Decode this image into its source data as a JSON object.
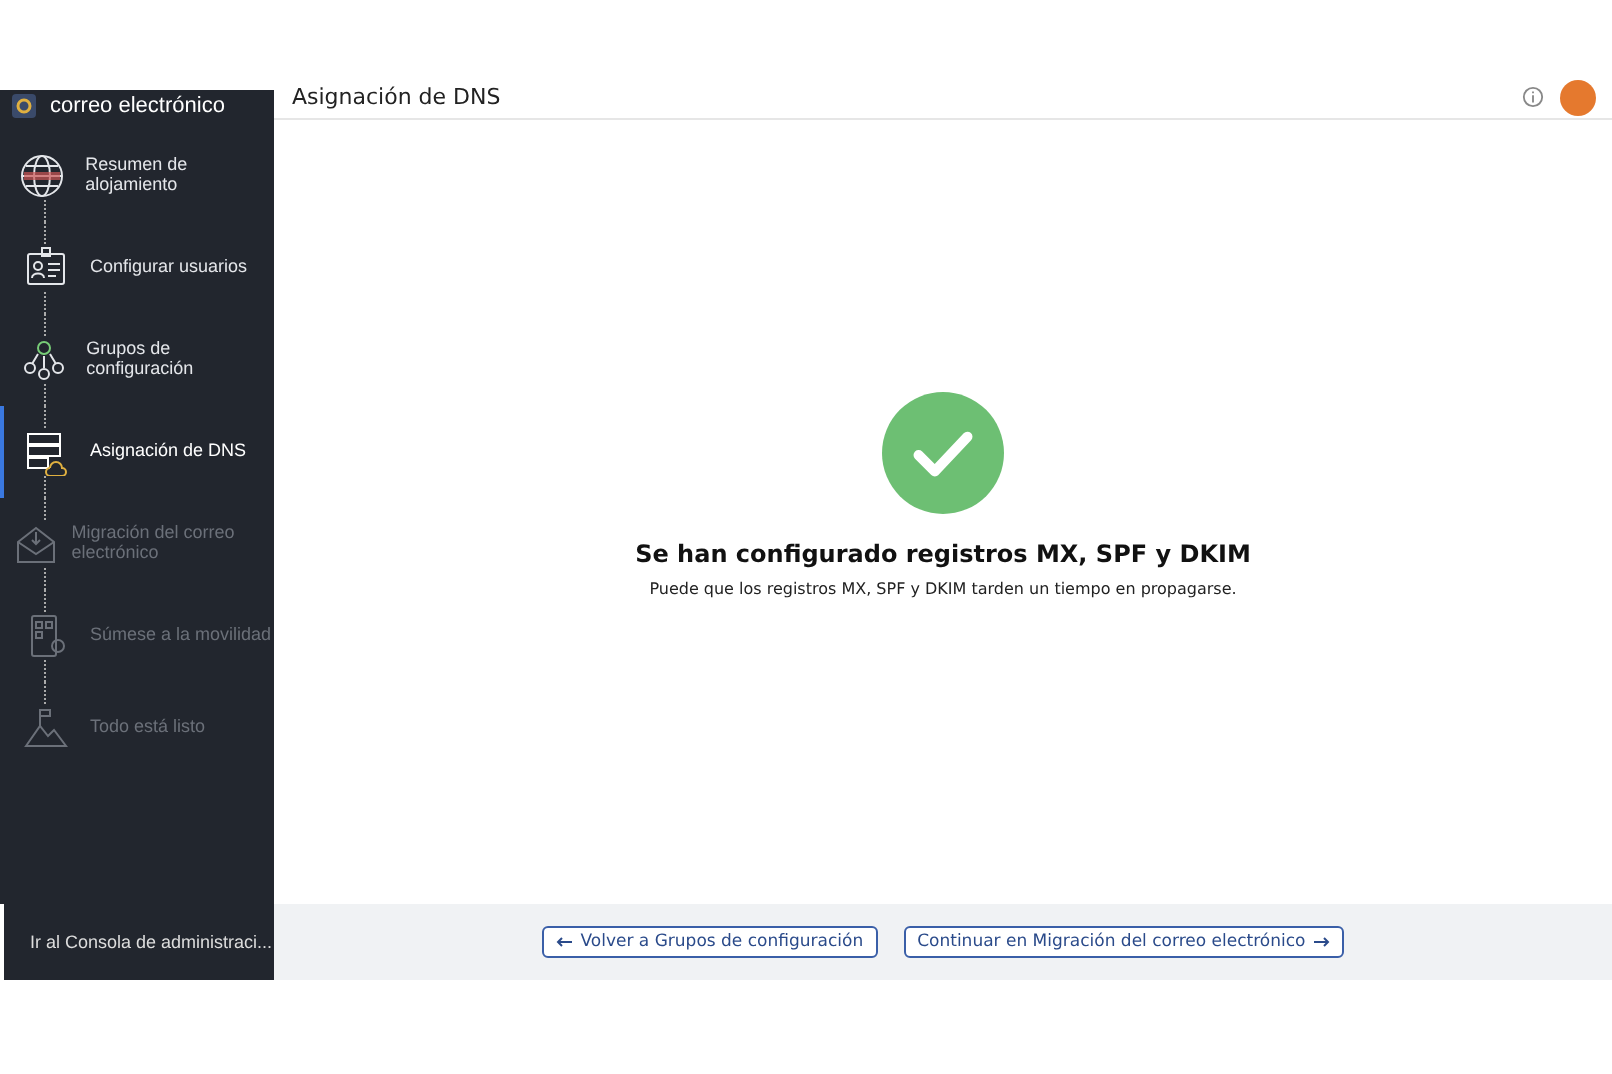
{
  "sidebar": {
    "title": "correo electrónico",
    "steps": [
      {
        "label": "Resumen de alojamiento",
        "selected": false,
        "disabled": false
      },
      {
        "label": "Configurar usuarios",
        "selected": false,
        "disabled": false
      },
      {
        "label": "Grupos de configuración",
        "selected": false,
        "disabled": false
      },
      {
        "label": "Asignación de DNS",
        "selected": true,
        "disabled": false
      },
      {
        "label": "Migración del correo electrónico",
        "selected": false,
        "disabled": true
      },
      {
        "label": "Súmese a la movilidad",
        "selected": false,
        "disabled": true
      },
      {
        "label": "Todo está listo",
        "selected": false,
        "disabled": true
      }
    ],
    "footer_link": "Ir al Consola de administraci..."
  },
  "header": {
    "title": "Asignación de DNS"
  },
  "result": {
    "heading": "Se han configurado registros MX, SPF y DKIM",
    "message": "Puede que los registros MX, SPF y DKIM tarden un tiempo en propagarse."
  },
  "footer": {
    "back_button": "Volver a Grupos de configuración",
    "next_button": "Continuar en Migración del correo electrónico"
  }
}
